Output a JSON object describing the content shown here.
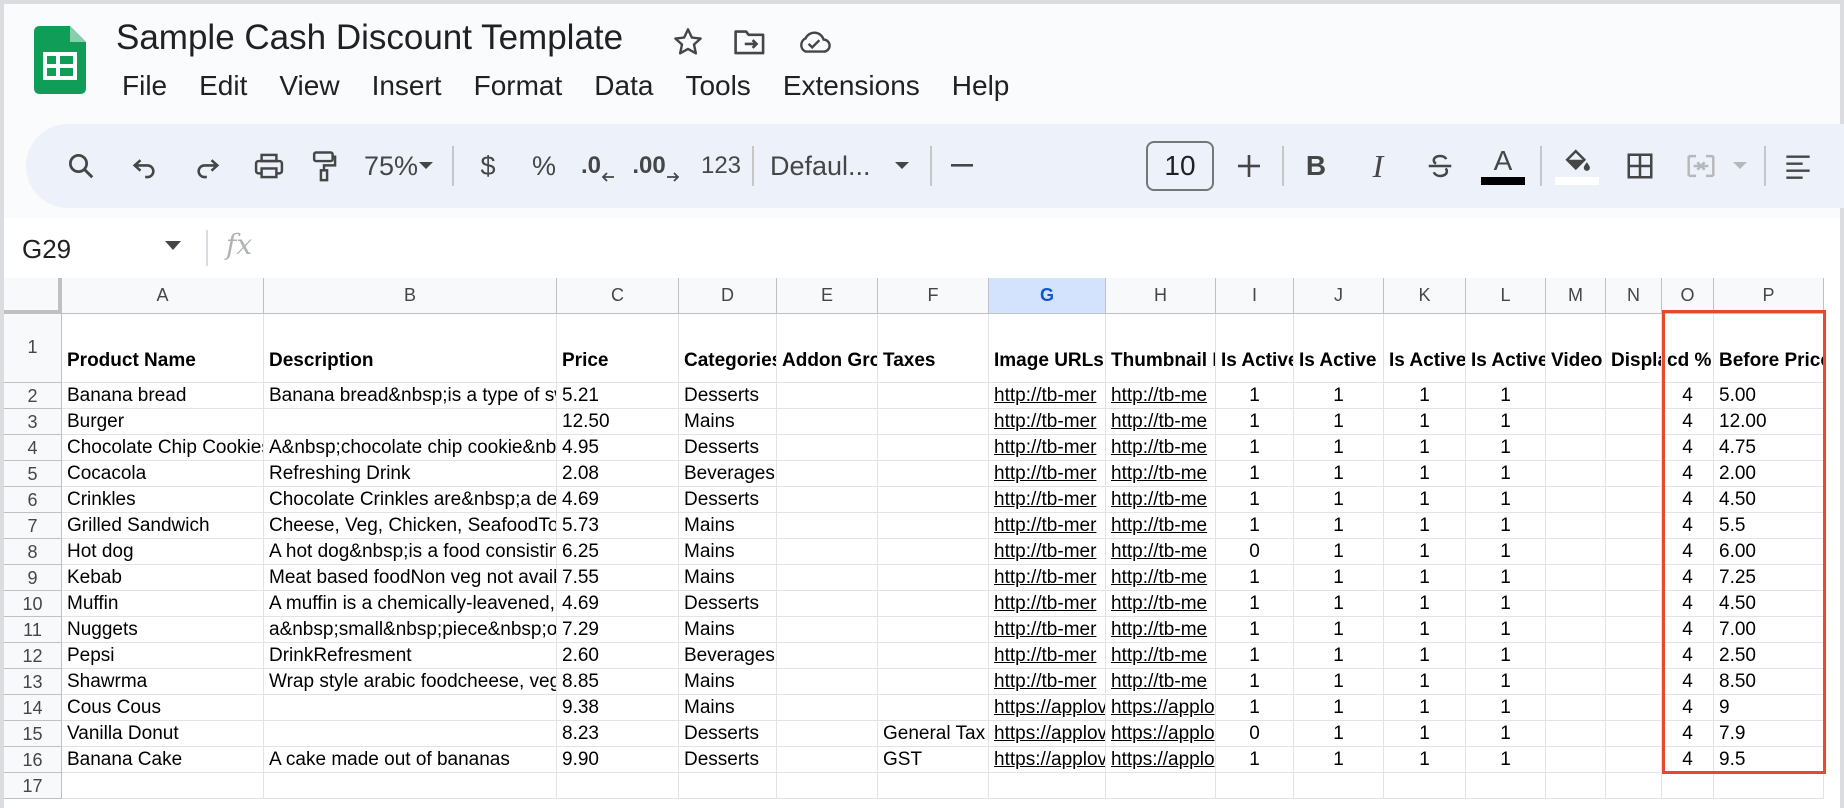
{
  "document": {
    "title": "Sample Cash Discount Template",
    "menu": [
      "File",
      "Edit",
      "View",
      "Insert",
      "Format",
      "Data",
      "Tools",
      "Extensions",
      "Help"
    ]
  },
  "toolbar": {
    "zoom": "75%",
    "currency_label": "$",
    "percent_label": "%",
    "decrease_decimal_label": ".0",
    "increase_decimal_label": ".00",
    "number_format_label": "123",
    "font_name": "Defaul...",
    "font_size": "10",
    "bold_label": "B",
    "italic_label": "I",
    "text_color_label": "A"
  },
  "formula_bar": {
    "cell_ref": "G29",
    "fx_label": "fx"
  },
  "sheet": {
    "columns": [
      "A",
      "B",
      "C",
      "D",
      "E",
      "F",
      "G",
      "H",
      "I",
      "J",
      "K",
      "L",
      "M",
      "N",
      "O",
      "P"
    ],
    "selected_column": "G",
    "row_numbers": [
      "1",
      "2",
      "3",
      "4",
      "5",
      "6",
      "7",
      "8",
      "9",
      "10",
      "11",
      "12",
      "13",
      "14",
      "15",
      "16",
      "17"
    ],
    "header_row": [
      "Product Name",
      "Description",
      "Price",
      "Categories",
      "Addon Grou",
      "Taxes",
      "Image URLs",
      "Thumbnail Im",
      "Is Active",
      "Is Active F",
      "Is Active",
      "Is Active",
      "Video U",
      "Displa",
      "cd %",
      "Before Price"
    ],
    "rows": [
      [
        "Banana bread",
        "Banana bread&nbsp;is a type of swe",
        "5.21",
        "Desserts",
        "",
        "",
        "http://tb-mer",
        "http://tb-me",
        "1",
        "1",
        "1",
        "1",
        "",
        "",
        "4",
        "5.00"
      ],
      [
        "Burger",
        "",
        "12.50",
        "Mains",
        "",
        "",
        "http://tb-mer",
        "http://tb-me",
        "1",
        "1",
        "1",
        "1",
        "",
        "",
        "4",
        "12.00"
      ],
      [
        "Chocolate Chip Cookies",
        "A&nbsp;chocolate chip cookie&nbs",
        "4.95",
        "Desserts",
        "",
        "",
        "http://tb-mer",
        "http://tb-me",
        "1",
        "1",
        "1",
        "1",
        "",
        "",
        "4",
        "4.75"
      ],
      [
        "Cocacola",
        "Refreshing Drink",
        "2.08",
        "Beverages",
        "",
        "",
        "http://tb-mer",
        "http://tb-me",
        "1",
        "1",
        "1",
        "1",
        "",
        "",
        "4",
        "2.00"
      ],
      [
        "Crinkles",
        "Chocolate Crinkles are&nbsp;a delic",
        "4.69",
        "Desserts",
        "",
        "",
        "http://tb-mer",
        "http://tb-me",
        "1",
        "1",
        "1",
        "1",
        "",
        "",
        "4",
        "4.50"
      ],
      [
        "Grilled Sandwich",
        "Cheese, Veg, Chicken, SeafoodToppi",
        "5.73",
        "Mains",
        "",
        "",
        "http://tb-mer",
        "http://tb-me",
        "1",
        "1",
        "1",
        "1",
        "",
        "",
        "4",
        "5.5"
      ],
      [
        "Hot dog",
        "A hot dog&nbsp;is a food consisting",
        "6.25",
        "Mains",
        "",
        "",
        "http://tb-mer",
        "http://tb-me",
        "0",
        "1",
        "1",
        "1",
        "",
        "",
        "4",
        "6.00"
      ],
      [
        "Kebab",
        "Meat based foodNon veg not availa",
        "7.55",
        "Mains",
        "",
        "",
        "http://tb-mer",
        "http://tb-me",
        "1",
        "1",
        "1",
        "1",
        "",
        "",
        "4",
        "7.25"
      ],
      [
        "Muffin",
        "A muffin is a chemically-leavened, b",
        "4.69",
        "Desserts",
        "",
        "",
        "http://tb-mer",
        "http://tb-me",
        "1",
        "1",
        "1",
        "1",
        "",
        "",
        "4",
        "4.50"
      ],
      [
        "Nuggets",
        "a&nbsp;small&nbsp;piece&nbsp;of",
        "7.29",
        "Mains",
        "",
        "",
        "http://tb-mer",
        "http://tb-me",
        "1",
        "1",
        "1",
        "1",
        "",
        "",
        "4",
        "7.00"
      ],
      [
        "Pepsi",
        "DrinkRefresment",
        "2.60",
        "Beverages",
        "",
        "",
        "http://tb-mer",
        "http://tb-me",
        "1",
        "1",
        "1",
        "1",
        "",
        "",
        "4",
        "2.50"
      ],
      [
        "Shawrma",
        "Wrap style arabic foodcheese, veg, c",
        "8.85",
        "Mains",
        "",
        "",
        "http://tb-mer",
        "http://tb-me",
        "1",
        "1",
        "1",
        "1",
        "",
        "",
        "4",
        "8.50"
      ],
      [
        "Cous Cous",
        "",
        "9.38",
        "Mains",
        "",
        "",
        "https://applov",
        "https://applo",
        "1",
        "1",
        "1",
        "1",
        "",
        "",
        "4",
        "9"
      ],
      [
        "Vanilla Donut",
        "",
        "8.23",
        "Desserts",
        "",
        "General Tax",
        "https://applov",
        "https://applo",
        "0",
        "1",
        "1",
        "1",
        "",
        "",
        "4",
        "7.9"
      ],
      [
        "Banana Cake",
        "A cake made out of bananas",
        "9.90",
        "Desserts",
        "",
        "GST",
        "https://applov",
        "https://applo",
        "1",
        "1",
        "1",
        "1",
        "",
        "",
        "4",
        "9.5"
      ],
      [
        "",
        "",
        "",
        "",
        "",
        "",
        "",
        "",
        "",
        "",
        "",
        "",
        "",
        "",
        "",
        ""
      ]
    ]
  },
  "colors": {
    "logo_green": "#0f9d58",
    "selected_header": "#d3e3fd",
    "highlight_border": "#e8492d",
    "toolbar_bg": "#edf2fa"
  }
}
